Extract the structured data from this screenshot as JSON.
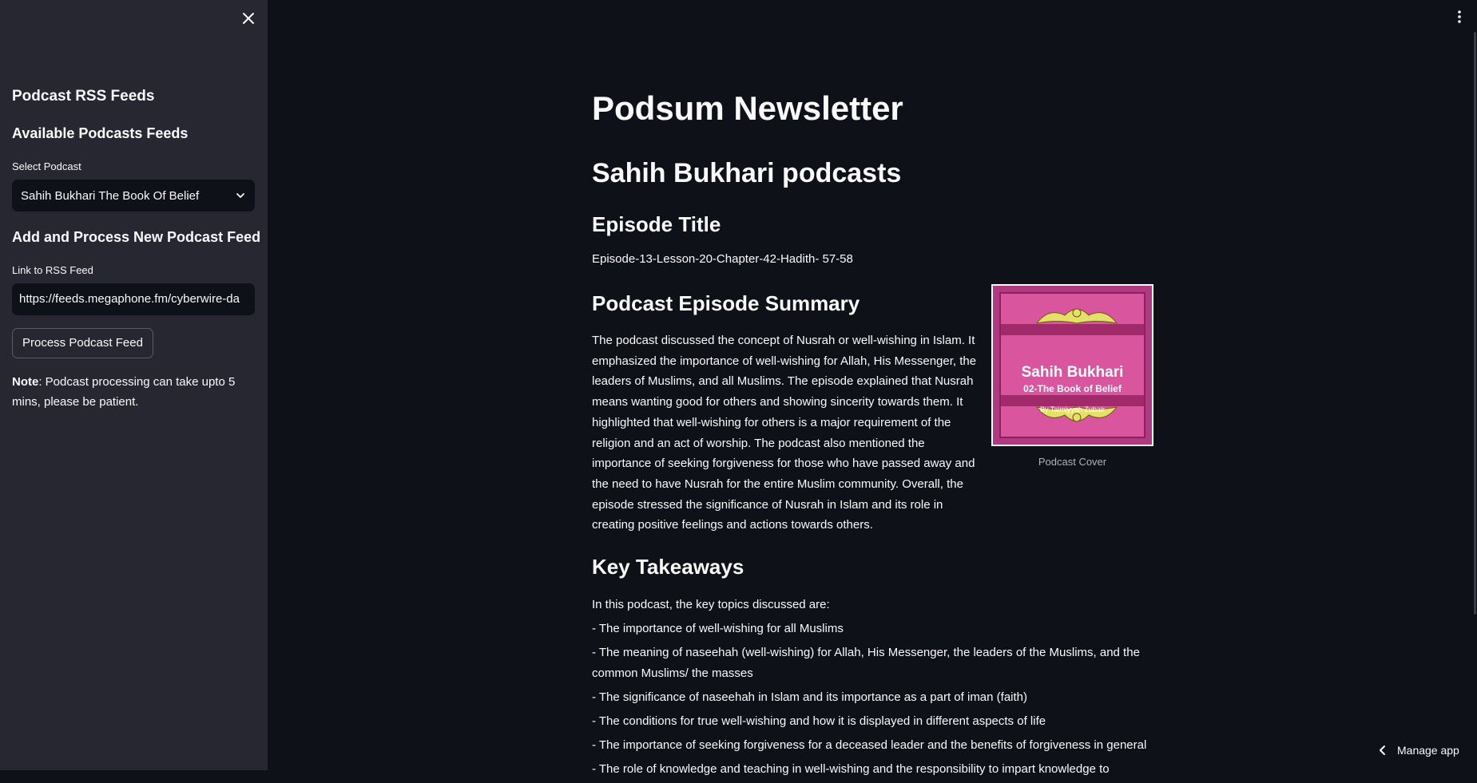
{
  "sidebar": {
    "close_icon": "close-icon",
    "heading": "Podcast RSS Feeds",
    "available_heading": "Available Podcasts Feeds",
    "select_label": "Select Podcast",
    "select_value": "Sahih Bukhari The Book Of Belief",
    "add_heading": "Add and Process New Podcast Feed",
    "link_label": "Link to RSS Feed",
    "link_value": "https://feeds.megaphone.fm/cyberwire-da",
    "process_button": "Process Podcast Feed",
    "note_bold": "Note",
    "note_text": ": Podcast processing can take upto 5 mins, please be patient."
  },
  "main": {
    "title": "Podsum Newsletter",
    "subtitle": "Sahih Bukhari podcasts",
    "episode_heading": "Episode Title",
    "episode_title": "Episode-13-Lesson-20-Chapter-42-Hadith- 57-58",
    "summary_heading": "Podcast Episode Summary",
    "summary": "The podcast discussed the concept of Nusrah or well-wishing in Islam. It emphasized the importance of well-wishing for Allah, His Messenger, the leaders of Muslims, and all Muslims. The episode explained that Nusrah means wanting good for others and showing sincerity towards them. It highlighted that well-wishing for others is a major requirement of the religion and an act of worship. The podcast also mentioned the importance of seeking forgiveness for those who have passed away and the need to have Nusrah for the entire Muslim community. Overall, the episode stressed the significance of Nusrah in Islam and its role in creating positive feelings and actions towards others.",
    "cover": {
      "title": "Sahih Bukhari",
      "subtitle": "02-The Book of Belief",
      "author": "By Taimiyyah Zubair",
      "caption": "Podcast Cover"
    },
    "takeaways_heading": "Key Takeaways",
    "takeaways_intro": "In this podcast, the key topics discussed are:",
    "takeaways": [
      "- The importance of well-wishing for all Muslims",
      "- The meaning of naseehah (well-wishing) for Allah, His Messenger, the leaders of the Muslims, and the common Muslims/ the masses",
      "- The significance of naseehah in Islam and its importance as a part of iman (faith)",
      "- The conditions for true well-wishing and how it is displayed in different aspects of life",
      "- The importance of seeking forgiveness for a deceased leader and the benefits of forgiveness in general",
      "- The role of knowledge and teaching in well-wishing and the responsibility to impart knowledge to"
    ]
  },
  "footer": {
    "manage_app": "Manage app"
  },
  "colors": {
    "background": "#0e1117",
    "sidebar": "#262730",
    "text": "#fafafa"
  }
}
